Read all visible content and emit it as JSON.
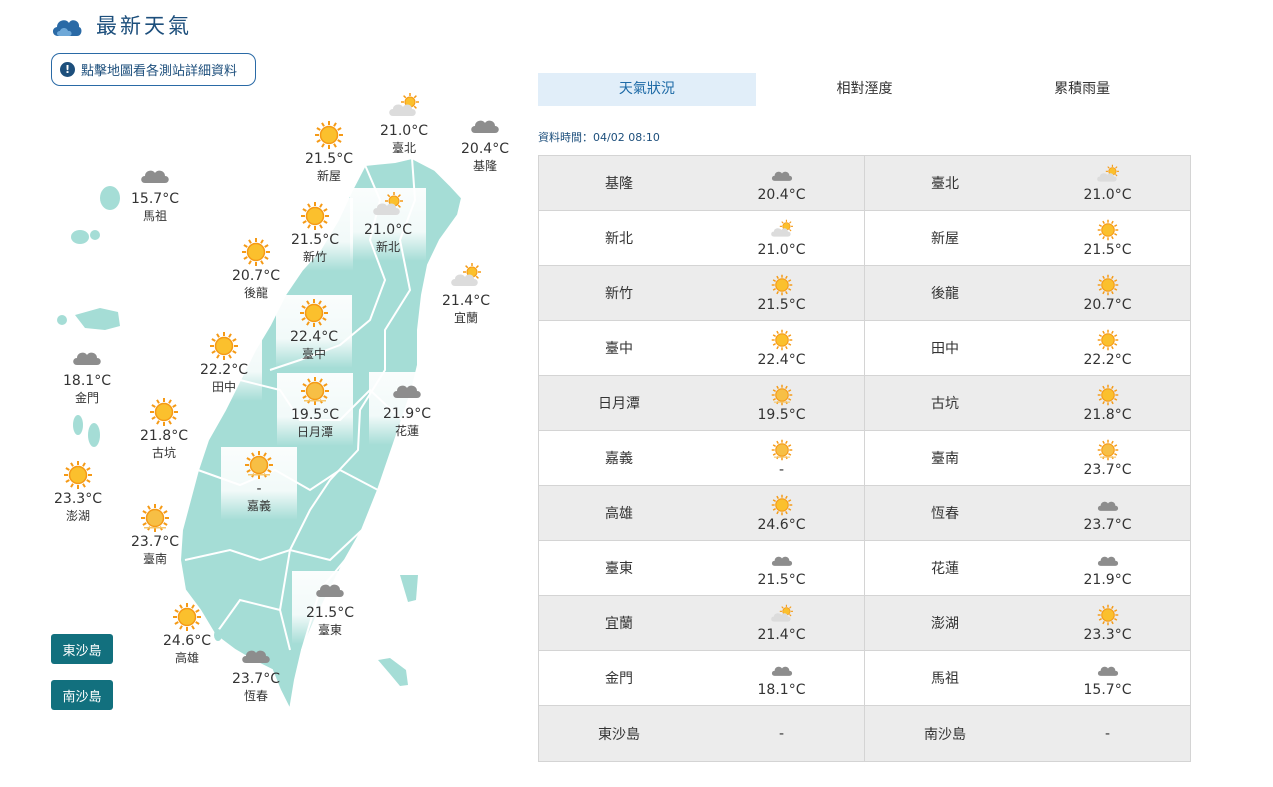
{
  "header": {
    "title": "最新天氣",
    "icon": "cloud-icon"
  },
  "notice": {
    "label": "點擊地圖看各測站詳細資料",
    "icon": "exclamation-icon"
  },
  "tabs": [
    {
      "label": "天氣狀況",
      "active": true
    },
    {
      "label": "相對溼度",
      "active": false
    },
    {
      "label": "累積雨量",
      "active": false
    }
  ],
  "data_time": "資料時間：04/02 08:10",
  "map_stations": [
    {
      "name": "臺北",
      "temp": "21.0°C",
      "icon": "sun-cloud-icon"
    },
    {
      "name": "基隆",
      "temp": "20.4°C",
      "icon": "cloud-icon"
    },
    {
      "name": "新屋",
      "temp": "21.5°C",
      "icon": "sun-icon"
    },
    {
      "name": "新北",
      "temp": "21.0°C",
      "icon": "sun-cloud-icon"
    },
    {
      "name": "新竹",
      "temp": "21.5°C",
      "icon": "sun-icon"
    },
    {
      "name": "馬祖",
      "temp": "15.7°C",
      "icon": "cloud-icon"
    },
    {
      "name": "後龍",
      "temp": "20.7°C",
      "icon": "sun-icon"
    },
    {
      "name": "宜蘭",
      "temp": "21.4°C",
      "icon": "sun-cloud-icon"
    },
    {
      "name": "臺中",
      "temp": "22.4°C",
      "icon": "sun-icon"
    },
    {
      "name": "田中",
      "temp": "22.2°C",
      "icon": "sun-icon"
    },
    {
      "name": "金門",
      "temp": "18.1°C",
      "icon": "cloud-icon"
    },
    {
      "name": "日月潭",
      "temp": "19.5°C",
      "icon": "sun-hazy-icon"
    },
    {
      "name": "花蓮",
      "temp": "21.9°C",
      "icon": "cloud-icon"
    },
    {
      "name": "古坑",
      "temp": "21.8°C",
      "icon": "sun-icon"
    },
    {
      "name": "嘉義",
      "temp": "-",
      "icon": "sun-hazy-icon"
    },
    {
      "name": "澎湖",
      "temp": "23.3°C",
      "icon": "sun-icon"
    },
    {
      "name": "臺南",
      "temp": "23.7°C",
      "icon": "sun-hazy-icon"
    },
    {
      "name": "臺東",
      "temp": "21.5°C",
      "icon": "cloud-icon"
    },
    {
      "name": "高雄",
      "temp": "24.6°C",
      "icon": "sun-icon"
    },
    {
      "name": "恆春",
      "temp": "23.7°C",
      "icon": "cloud-icon"
    }
  ],
  "island_buttons": [
    "東沙島",
    "南沙島"
  ],
  "table_rows": [
    [
      {
        "name": "基隆",
        "temp": "20.4°C",
        "icon": "cloud-icon"
      },
      {
        "name": "臺北",
        "temp": "21.0°C",
        "icon": "sun-cloud-icon"
      }
    ],
    [
      {
        "name": "新北",
        "temp": "21.0°C",
        "icon": "sun-cloud-icon"
      },
      {
        "name": "新屋",
        "temp": "21.5°C",
        "icon": "sun-icon"
      }
    ],
    [
      {
        "name": "新竹",
        "temp": "21.5°C",
        "icon": "sun-icon"
      },
      {
        "name": "後龍",
        "temp": "20.7°C",
        "icon": "sun-icon"
      }
    ],
    [
      {
        "name": "臺中",
        "temp": "22.4°C",
        "icon": "sun-icon"
      },
      {
        "name": "田中",
        "temp": "22.2°C",
        "icon": "sun-icon"
      }
    ],
    [
      {
        "name": "日月潭",
        "temp": "19.5°C",
        "icon": "sun-hazy-icon"
      },
      {
        "name": "古坑",
        "temp": "21.8°C",
        "icon": "sun-icon"
      }
    ],
    [
      {
        "name": "嘉義",
        "temp": "-",
        "icon": "sun-hazy-icon"
      },
      {
        "name": "臺南",
        "temp": "23.7°C",
        "icon": "sun-hazy-icon"
      }
    ],
    [
      {
        "name": "高雄",
        "temp": "24.6°C",
        "icon": "sun-icon"
      },
      {
        "name": "恆春",
        "temp": "23.7°C",
        "icon": "cloud-icon"
      }
    ],
    [
      {
        "name": "臺東",
        "temp": "21.5°C",
        "icon": "cloud-icon"
      },
      {
        "name": "花蓮",
        "temp": "21.9°C",
        "icon": "cloud-icon"
      }
    ],
    [
      {
        "name": "宜蘭",
        "temp": "21.4°C",
        "icon": "sun-cloud-icon"
      },
      {
        "name": "澎湖",
        "temp": "23.3°C",
        "icon": "sun-icon"
      }
    ],
    [
      {
        "name": "金門",
        "temp": "18.1°C",
        "icon": "cloud-icon"
      },
      {
        "name": "馬祖",
        "temp": "15.7°C",
        "icon": "cloud-icon"
      }
    ],
    [
      {
        "name": "東沙島",
        "temp": "-",
        "icon": ""
      },
      {
        "name": "南沙島",
        "temp": "-",
        "icon": ""
      }
    ]
  ],
  "colors": {
    "brand": "#1d4f7c",
    "land": "#a5ddd6",
    "island_button": "#12707e",
    "active_tab": "#e1eef9",
    "sun": "#f7a21b",
    "cloud": "#8c8c8c"
  }
}
